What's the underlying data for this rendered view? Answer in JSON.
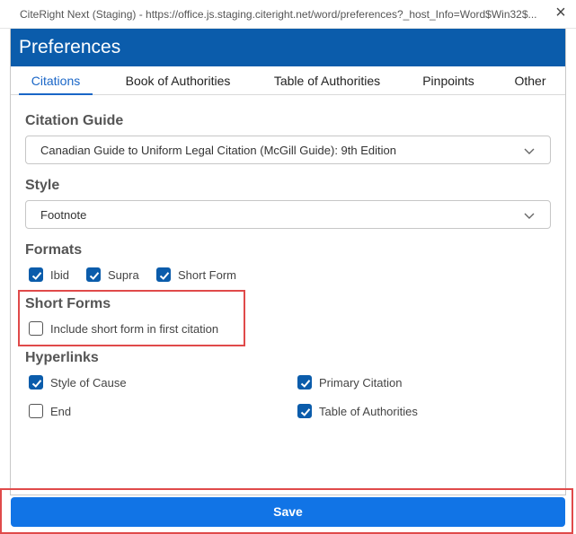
{
  "window": {
    "title": "CiteRight Next (Staging) - https://office.js.staging.citeright.net/word/preferences?_host_Info=Word$Win32$..."
  },
  "header": {
    "title": "Preferences"
  },
  "tabs": [
    {
      "label": "Citations",
      "active": true
    },
    {
      "label": "Book of Authorities",
      "active": false
    },
    {
      "label": "Table of Authorities",
      "active": false
    },
    {
      "label": "Pinpoints",
      "active": false
    },
    {
      "label": "Other",
      "active": false
    }
  ],
  "citation_guide": {
    "label": "Citation Guide",
    "value": "Canadian Guide to Uniform Legal Citation (McGill Guide): 9th Edition"
  },
  "style": {
    "label": "Style",
    "value": "Footnote"
  },
  "formats": {
    "label": "Formats",
    "options": [
      {
        "label": "Ibid",
        "checked": true
      },
      {
        "label": "Supra",
        "checked": true
      },
      {
        "label": "Short Form",
        "checked": true
      }
    ]
  },
  "short_forms": {
    "label": "Short Forms",
    "options": [
      {
        "label": "Include short form in first citation",
        "checked": false
      }
    ]
  },
  "hyperlinks": {
    "label": "Hyperlinks",
    "options": [
      {
        "label": "Style of Cause",
        "checked": true
      },
      {
        "label": "Primary Citation",
        "checked": true
      },
      {
        "label": "End",
        "checked": false
      },
      {
        "label": "Table of Authorities",
        "checked": true
      }
    ]
  },
  "footer": {
    "save_label": "Save"
  },
  "colors": {
    "accent": "#0b5cab",
    "save": "#1174e6",
    "highlight": "#e04a4a"
  }
}
